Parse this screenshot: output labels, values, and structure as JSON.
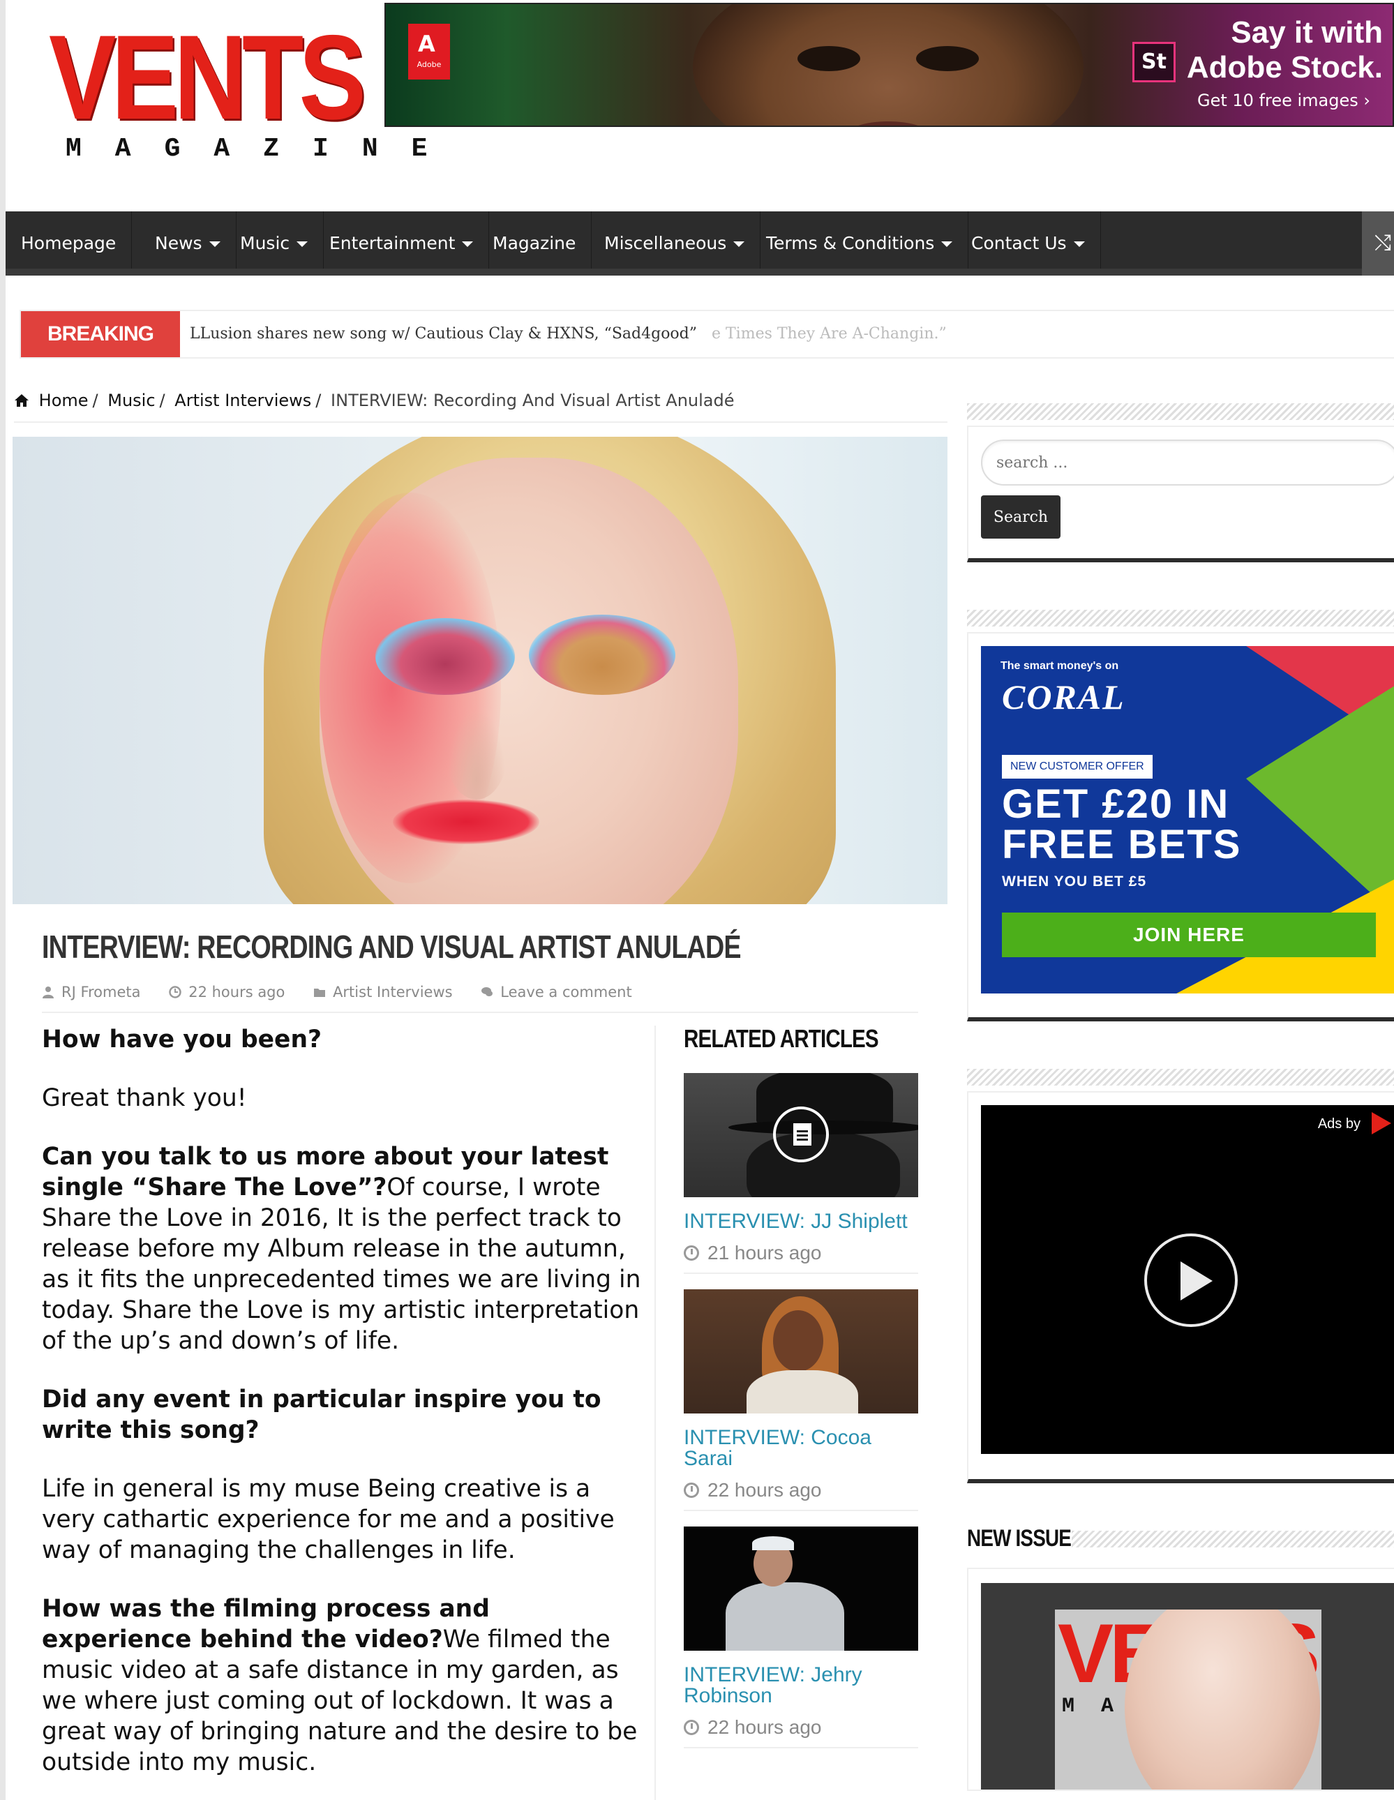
{
  "brand": {
    "logo_main": "VENTS",
    "logo_sub": "MAGAZINE",
    "accent_color": "#e32119"
  },
  "top_ad": {
    "badge": "Adobe",
    "st_label": "St",
    "headline_1": "Say it with",
    "headline_2": "Adobe Stock.",
    "cta": "Get 10 free images ›"
  },
  "nav": {
    "items": [
      {
        "label": "Homepage",
        "has_dropdown": false
      },
      {
        "label": "News",
        "has_dropdown": true
      },
      {
        "label": "Music",
        "has_dropdown": true
      },
      {
        "label": "Entertainment",
        "has_dropdown": true
      },
      {
        "label": "Magazine",
        "has_dropdown": false
      },
      {
        "label": "Miscellaneous",
        "has_dropdown": true
      },
      {
        "label": "Terms & Conditions",
        "has_dropdown": true
      },
      {
        "label": "Contact Us",
        "has_dropdown": true
      }
    ],
    "shuffle_icon": "shuffle-icon"
  },
  "breaking": {
    "label": "BREAKING NEWS",
    "headline": "LLusion shares new song w/ Cautious Clay & HXNS, “Sad4good”",
    "ghost": "e Times They Are A-Changin.”"
  },
  "breadcrumb": {
    "home": "Home",
    "music": "Music",
    "category": "Artist Interviews",
    "current": "INTERVIEW: Recording And Visual Artist Anuladé"
  },
  "article": {
    "title": "INTERVIEW: RECORDING AND VISUAL ARTIST ANULADÉ",
    "author": "RJ Frometa",
    "time": "22 hours ago",
    "category": "Artist Interviews",
    "comments": "Leave a comment",
    "q1": "How have you been?",
    "a1": "Great thank you!",
    "q2": "Can you talk to us more about your latest single “Share The Love”?",
    "a2": "Of course, I wrote Share the Love in 2016,  It is the perfect track to release before my Album release in the autumn, as it fits the unprecedented times we are living in today. Share the Love is my artistic interpretation of the up’s and down’s of life.",
    "q3": "Did any event in particular inspire you to write this song?",
    "a3": "Life in general is my muse  Being creative is a very cathartic experience for me and a positive way of managing the challenges in life.",
    "q4": "How was the filming process and experience behind the video?",
    "a4": "We filmed the music video at a safe distance in my garden, as we where just coming out of lockdown. It was a great way of bringing nature and the desire to be outside into my music."
  },
  "related": {
    "title": "RELATED ARTICLES",
    "items": [
      {
        "title": "INTERVIEW: JJ Shiplett",
        "time": "21 hours ago"
      },
      {
        "title": "INTERVIEW: Cocoa Sarai",
        "time": "22 hours ago"
      },
      {
        "title": "INTERVIEW: Jehry Robinson",
        "time": "22 hours ago"
      }
    ]
  },
  "sidebar": {
    "search_placeholder": "search ...",
    "search_button": "Search",
    "coral": {
      "tagline": "The smart money's on",
      "logo": "CORAL",
      "offer": "NEW CUSTOMER OFFER",
      "headline_1": "GET £20 IN",
      "headline_2": "FREE BETS",
      "sub": "WHEN YOU BET £5",
      "cta": "JOIN HERE"
    },
    "video_ad": {
      "ads_by": "Ads by"
    },
    "new_issue": {
      "title": "NEW ISSUE",
      "cover_logo": "VENTS",
      "cover_mag": "MAGAZINE"
    }
  }
}
